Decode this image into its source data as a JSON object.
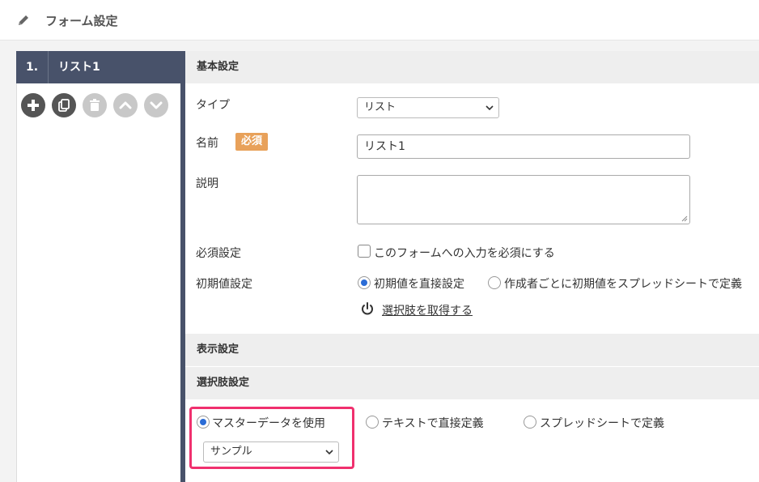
{
  "header": {
    "title": "フォーム設定",
    "icon": "pencil-icon"
  },
  "list": {
    "number": "1.",
    "name": "リスト1",
    "tools": [
      "add-icon",
      "copy-icon",
      "trash-icon",
      "chevron-up-icon",
      "chevron-down-icon"
    ]
  },
  "basic": {
    "section_title": "基本設定",
    "type_label": "タイプ",
    "type_value": "リスト",
    "name_label": "名前",
    "required_badge": "必須",
    "name_value": "リスト1",
    "desc_label": "説明",
    "required_label": "必須設定",
    "required_checkbox": "このフォームへの入力を必須にする",
    "initial_label": "初期値設定",
    "initial_opt1": "初期値を直接設定",
    "initial_opt2": "作成者ごとに初期値をスプレッドシートで定義",
    "fetch_link": "選択肢を取得する"
  },
  "display": {
    "section_title": "表示設定"
  },
  "choices": {
    "section_title": "選択肢設定",
    "opt_master": "マスターデータを使用",
    "opt_text": "テキストで直接定義",
    "opt_sheet": "スプレッドシートで定義",
    "master_select": "サンプル"
  },
  "colors": {
    "sidebar": "#48526a",
    "accent": "#2b6cd6",
    "badge": "#e8a15a",
    "highlight": "#f0306e"
  }
}
